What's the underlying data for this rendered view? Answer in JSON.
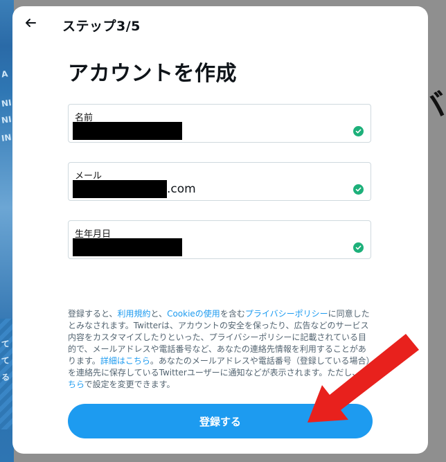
{
  "background": {
    "left_marks": [
      "A",
      "NI",
      "NI",
      "IN",
      "て",
      "て",
      "る"
    ],
    "right_glyph": "バ"
  },
  "header": {
    "back_icon": "arrow-left-icon",
    "step": "ステップ3/5"
  },
  "title": "アカウントを作成",
  "fields": [
    {
      "label": "名前",
      "value_redacted": true,
      "suffix": ""
    },
    {
      "label": "メール",
      "value_redacted": true,
      "suffix": ".com"
    },
    {
      "label": "生年月日",
      "value_redacted": true,
      "suffix": ""
    }
  ],
  "legal": {
    "t1": "登録すると、",
    "terms_link": "利用規約",
    "t2": "と、",
    "cookie_link": "Cookieの使用",
    "t3": "を含む",
    "privacy_link": "プライバシーポリシー",
    "t4": "に同意したとみなされます。Twitterは、アカウントの安全を保ったり、広告などのサービス内容をカスタマイズしたりといった、プライバシーポリシーに記載されている目的で、メールアドレスや電話番号など、あなたの連絡先情報を利用することがあります。",
    "details_link": "詳細はこちら",
    "t5": "。あなたのメールアドレスや電話番号（登録している場合）を連絡先に保存しているTwitterユーザーに通知などが表示されます。ただし、",
    "settings_link": "こちら",
    "t6": "で設定を変更できます。"
  },
  "register_button": "登録する",
  "colors": {
    "accent": "#1d9bf0",
    "check": "#1db07a",
    "arrow": "#e8211d"
  }
}
